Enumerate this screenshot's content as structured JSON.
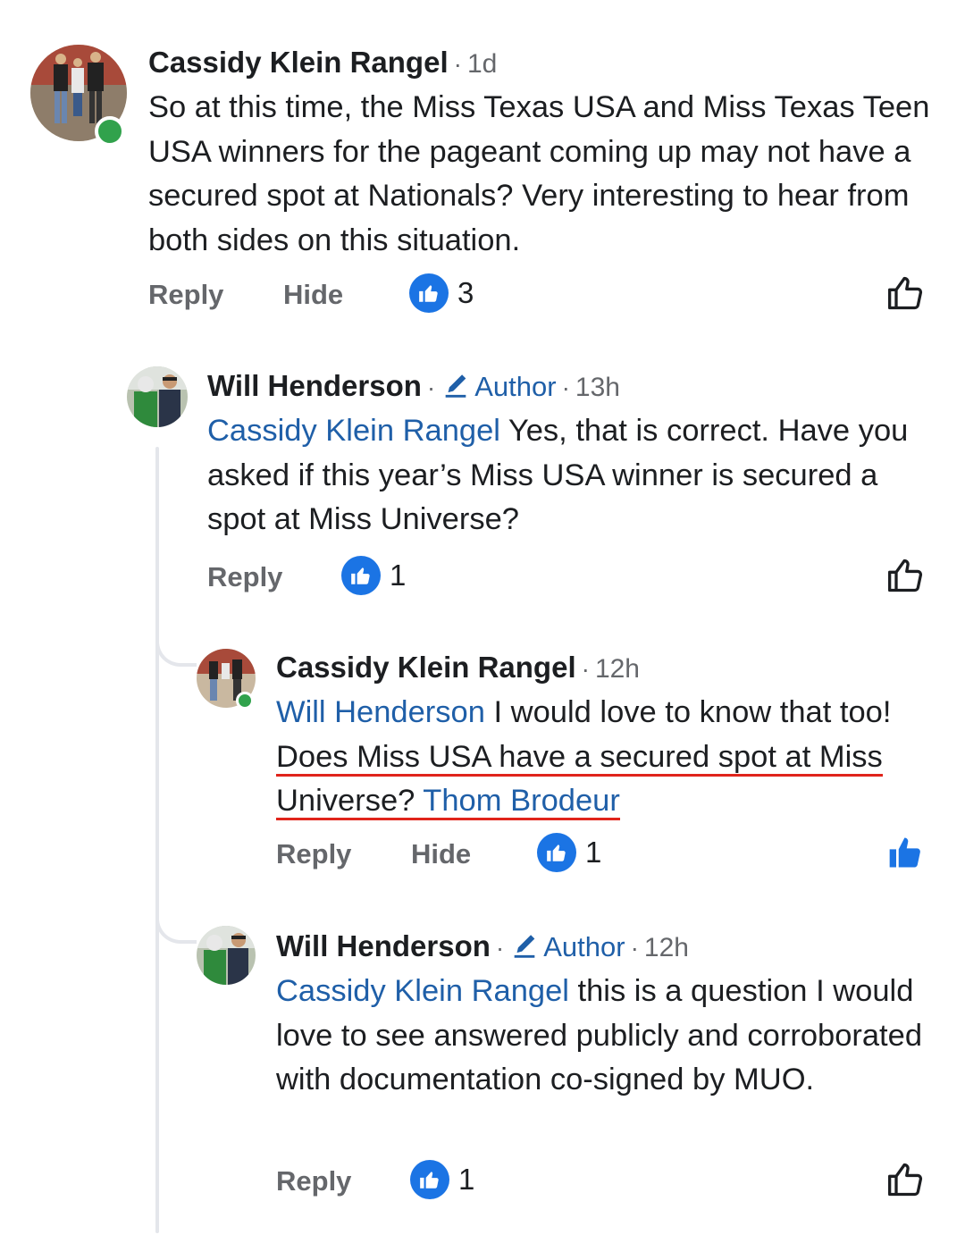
{
  "comments": [
    {
      "name": "Cassidy Klein Rangel",
      "time": "1d",
      "online": true,
      "text": "So at this time, the Miss Texas USA and Miss Texas Teen USA winners for the pageant coming up may not have a secured spot at Nationals? Very interesting to hear from both sides on this situation.",
      "reply_label": "Reply",
      "hide_label": "Hide",
      "reaction_count": "3",
      "liked": false
    },
    {
      "name": "Will Henderson",
      "author_badge": "Author",
      "time": "13h",
      "mention": "Cassidy Klein Rangel",
      "text": "Yes, that is correct. Have you asked if this year’s Miss USA winner is secured a spot at Miss Universe?",
      "reply_label": "Reply",
      "reaction_count": "1",
      "liked": false
    },
    {
      "name": "Cassidy Klein Rangel",
      "time": "12h",
      "online": true,
      "mention": "Will Henderson",
      "text_a": "I would love to know that too!",
      "text_underlined": "Does Miss USA have a secured spot at Miss Universe?",
      "mention_2": "Thom Brodeur",
      "reply_label": "Reply",
      "hide_label": "Hide",
      "reaction_count": "1",
      "liked": true
    },
    {
      "name": "Will Henderson",
      "author_badge": "Author",
      "time": "12h",
      "mention": "Cassidy Klein Rangel",
      "text": "this is a question I would love to see answered publicly and corroborated with documentation co-signed by MUO.",
      "reply_label": "Reply",
      "reaction_count": "1",
      "liked": false
    }
  ],
  "colors": {
    "link": "#1f5fa8",
    "reaction": "#1b74e4",
    "online": "#31a24c",
    "highlight_underline": "#e0241b"
  },
  "icons": [
    "pencil-icon",
    "thumbs-up-icon",
    "like-outline-icon",
    "like-filled-icon"
  ]
}
